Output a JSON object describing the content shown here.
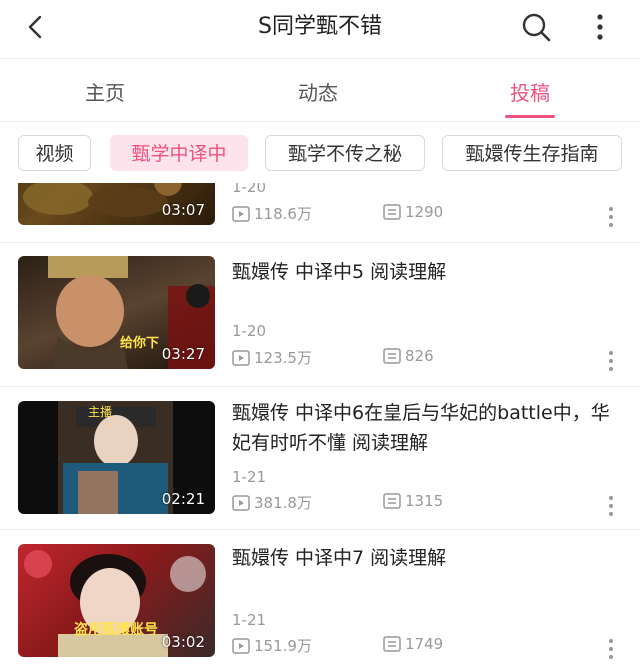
{
  "header": {
    "title": "S同学甄不错",
    "back_icon": "chevron-left-icon",
    "search_icon": "search-icon",
    "more_icon": "more-vertical-icon"
  },
  "tabs": [
    {
      "label": "主页",
      "active": false
    },
    {
      "label": "动态",
      "active": false
    },
    {
      "label": "投稿",
      "active": true
    }
  ],
  "accent_color": "#f1517f",
  "chips": [
    {
      "label": "视频",
      "active": false
    },
    {
      "label": "甄学中译中",
      "active": true
    },
    {
      "label": "甄学不传之秘",
      "active": false
    },
    {
      "label": "甄嬛传生存指南",
      "active": false
    }
  ],
  "videos": [
    {
      "title": "",
      "duration": "03:07",
      "date": "1-20",
      "plays": "118.6万",
      "danmaku": "1290",
      "overlay_caption": ""
    },
    {
      "title": "甄嬛传 中译中5 阅读理解",
      "duration": "03:27",
      "date": "1-20",
      "plays": "123.5万",
      "danmaku": "826",
      "overlay_caption": "给你下"
    },
    {
      "title": "甄嬛传 中译中6在皇后与华妃的battle中，华妃有时听不懂 阅读理解",
      "duration": "02:21",
      "date": "1-21",
      "plays": "381.8万",
      "danmaku": "1315",
      "overlay_caption": "主播"
    },
    {
      "title": "甄嬛传 中译中7 阅读理解",
      "duration": "03:02",
      "date": "1-21",
      "plays": "151.9万",
      "danmaku": "1749",
      "overlay_caption": "盗用甄嬛账号"
    }
  ]
}
